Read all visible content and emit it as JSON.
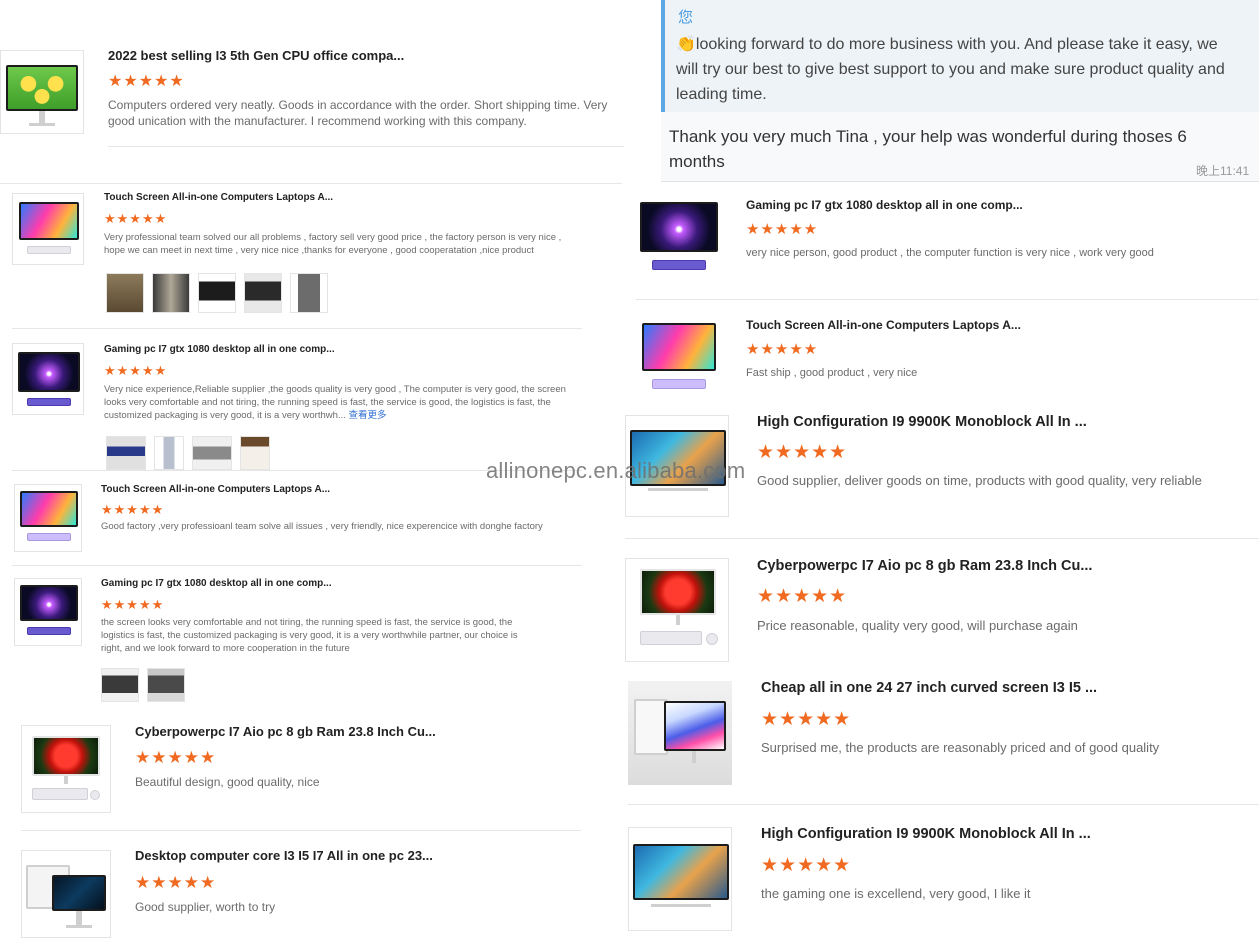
{
  "watermark": "allinonepc.en.alibaba.com",
  "chat": {
    "header_char": "您",
    "quote_icon": "clapping-hands-emoji",
    "quote_text": "looking forward to do more business with you. And please take it easy, we will try our best to give best support to you and make sure product quality and leading time.",
    "reply": "Thank you very much Tina , your help was wonderful during thoses   6 months",
    "time": "晚上11:41"
  },
  "stars": "★★★★★",
  "left_reviews": [
    {
      "title": "2022 best selling I3 5th Gen CPU office compa...",
      "text": "Computers ordered very neatly. Goods in accordance with the order. Short shipping time. Very good unication with the manufacturer. I recommend working with this company."
    },
    {
      "title": "Touch Screen All-in-one Computers Laptops A...",
      "text": "Very professional team solved our all problems , factory sell very good price , the factory person is very nice , hope we can meet in next time , very nice nice  ,thanks for everyone , good cooperatation ,nice product"
    },
    {
      "title": "Gaming pc I7 gtx 1080 desktop all in one comp...",
      "text": "Very nice experience,Reliable supplier ,the goods quality is very good , The computer is very good, the screen looks very comfortable and not tiring, the running speed is fast, the service is good, the logistics is fast, the customized packaging is very good, it is a very worthwh...",
      "more": "查看更多"
    },
    {
      "title": "Touch Screen All-in-one Computers Laptops A...",
      "text": "Good factory ,very professioanl team solve all issues , very friendly, nice experencice with donghe factory"
    },
    {
      "title": "Gaming pc I7 gtx 1080 desktop all in one comp...",
      "text": "the screen looks very comfortable and not tiring, the running speed is fast, the service is good, the logistics is fast, the customized packaging is very good, it is a very worthwhile partner, our choice is right, and we look forward to more cooperation in the future"
    },
    {
      "title": "Cyberpowerpc I7 Aio pc 8 gb Ram 23.8 Inch Cu...",
      "text": "Beautiful design, good quality, nice"
    },
    {
      "title": "Desktop computer core I3 I5 I7 All in one pc 23...",
      "text": "Good supplier, worth to try"
    }
  ],
  "right_reviews": [
    {
      "title": "Gaming pc I7 gtx 1080 desktop all in one comp...",
      "text": "very nice person, good product , the computer function is very nice , work very good"
    },
    {
      "title": "Touch Screen All-in-one Computers Laptops A...",
      "text": "Fast ship , good product , very nice"
    },
    {
      "title": "High Configuration I9 9900K Monoblock All In ...",
      "text": "Good supplier, deliver goods on time, products with good quality, very reliable"
    },
    {
      "title": "Cyberpowerpc I7 Aio pc 8 gb Ram 23.8 Inch Cu...",
      "text": "Price reasonable, quality very good, will purchase again"
    },
    {
      "title": "Cheap all in one 24 27 inch curved screen I3 I5 ...",
      "text": "Surprised me, the products are reasonably priced and of good quality"
    },
    {
      "title": "High Configuration I9 9900K Monoblock All In ...",
      "text": "the gaming one is excellend, very good, I like it"
    }
  ]
}
